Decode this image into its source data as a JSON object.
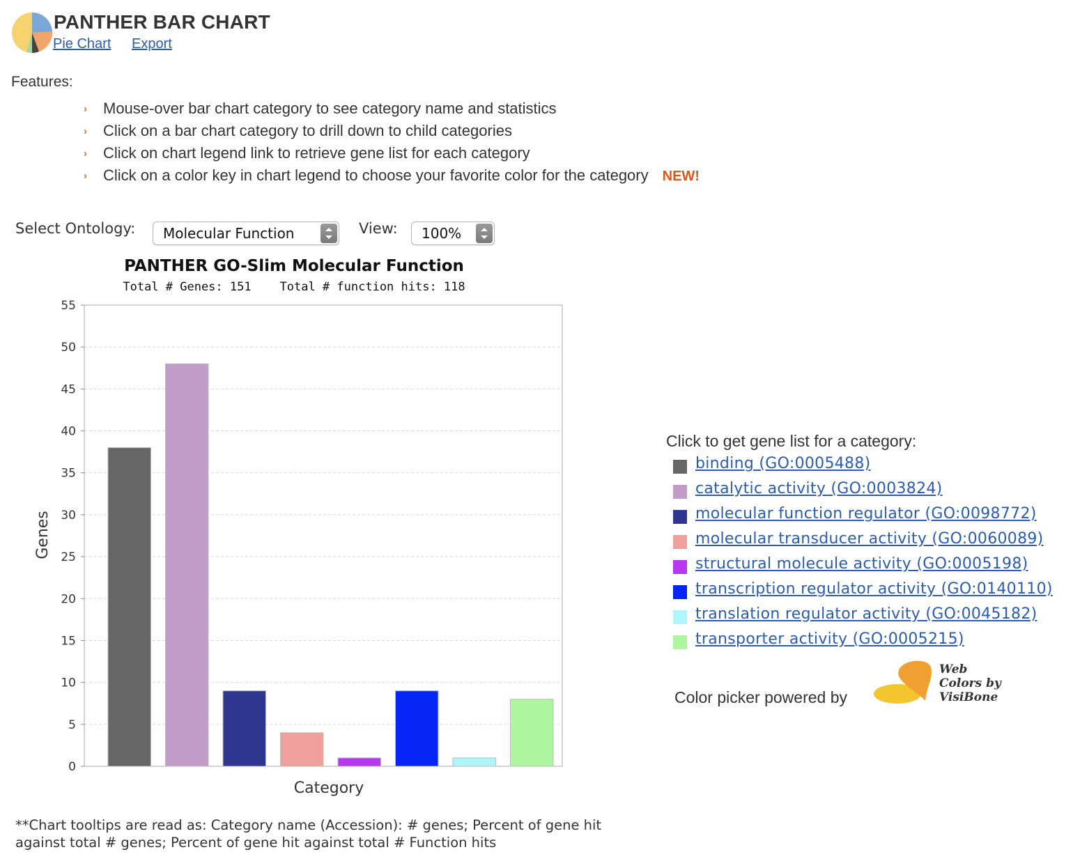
{
  "header": {
    "title": "PANTHER BAR CHART",
    "links": [
      "Pie Chart",
      "Export"
    ]
  },
  "features": {
    "label": "Features:",
    "items": [
      "Mouse-over bar chart category to see category name and statistics",
      "Click on a bar chart category to drill down to child categories",
      "Click on chart legend link to retrieve gene list for each category",
      "Click on a color key in chart legend to choose your favorite color for the category"
    ],
    "new_badge": "NEW!"
  },
  "controls": {
    "ontology_label": "Select Ontology:",
    "ontology_value": "Molecular Function",
    "view_label": "View:",
    "view_value": "100%"
  },
  "chart_data": {
    "type": "bar",
    "title": "PANTHER GO-Slim Molecular Function",
    "subtitle": "Total # Genes: 151    Total # function hits: 118",
    "xlabel": "Category",
    "ylabel": "Genes",
    "ylim": [
      0,
      55
    ],
    "yticks": [
      0,
      5,
      10,
      15,
      20,
      25,
      30,
      35,
      40,
      45,
      50,
      55
    ],
    "grid": true,
    "categories": [
      "binding (GO:0005488)",
      "catalytic activity (GO:0003824)",
      "molecular function regulator (GO:0098772)",
      "molecular transducer activity (GO:0060089)",
      "structural molecule activity (GO:0005198)",
      "transcription regulator activity (GO:0140110)",
      "translation regulator activity (GO:0045182)",
      "transporter activity (GO:0005215)"
    ],
    "values": [
      38,
      48,
      9,
      4,
      1,
      9,
      1,
      8
    ],
    "colors": [
      "#666666",
      "#c29cc8",
      "#2e3690",
      "#f0a09c",
      "#b639f0",
      "#0525f5",
      "#aef6fa",
      "#aef5a0"
    ]
  },
  "legend": {
    "title": "Click to get gene list for a category:",
    "items": [
      {
        "label": "binding (GO:0005488)",
        "color": "#666666"
      },
      {
        "label": "catalytic activity (GO:0003824)",
        "color": "#c29cc8"
      },
      {
        "label": "molecular function regulator (GO:0098772)",
        "color": "#2e3690"
      },
      {
        "label": "molecular transducer activity (GO:0060089)",
        "color": "#f0a09c"
      },
      {
        "label": "structural molecule activity (GO:0005198)",
        "color": "#b639f0"
      },
      {
        "label": "transcription regulator activity (GO:0140110)",
        "color": "#0525f5"
      },
      {
        "label": "translation regulator activity (GO:0045182)",
        "color": "#aef6fa"
      },
      {
        "label": "transporter activity (GO:0005215)",
        "color": "#aef5a0"
      }
    ]
  },
  "color_picker": {
    "text": "Color picker powered by",
    "logo_text": [
      "Web",
      "Colors by",
      "VisiBone"
    ]
  },
  "footnote": "**Chart tooltips are read as: Category name (Accession): # genes; Percent of gene hit against total # genes; Percent of gene hit against total # Function hits"
}
